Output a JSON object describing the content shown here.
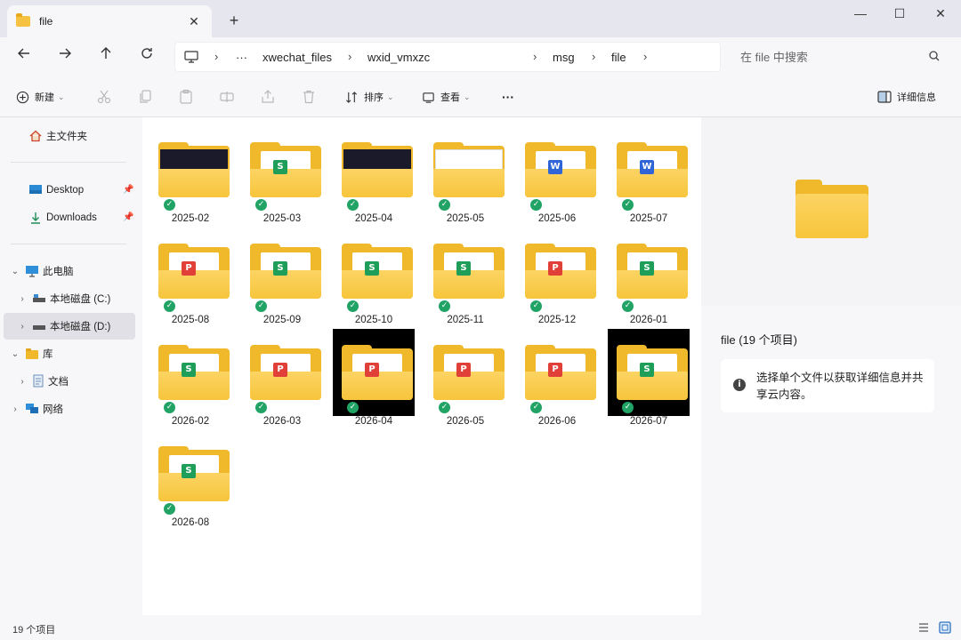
{
  "window": {
    "tab_title": "file",
    "new_tab": "+",
    "min": "—",
    "max": "☐",
    "close": "✕"
  },
  "address": {
    "ellipsis": "···",
    "crumbs": [
      "xwechat_files",
      "wxid_vmxzc",
      "msg",
      "file"
    ],
    "search_placeholder": "在 file 中搜索"
  },
  "toolbar": {
    "new_label": "新建",
    "sort_label": "排序",
    "view_label": "查看",
    "more_label": "···",
    "details_label": "详细信息"
  },
  "sidebar": {
    "home": "主文件夹",
    "desktop": "Desktop",
    "downloads": "Downloads",
    "this_pc": "此电脑",
    "drive_c": "本地磁盘 (C:)",
    "drive_d": "本地磁盘 (D:)",
    "library": "库",
    "documents": "文档",
    "network": "网络"
  },
  "folders": [
    {
      "name": "2025-02",
      "kind": "dark"
    },
    {
      "name": "2025-03",
      "kind": "S"
    },
    {
      "name": "2025-04",
      "kind": "dark"
    },
    {
      "name": "2025-05",
      "kind": "light"
    },
    {
      "name": "2025-06",
      "kind": "W"
    },
    {
      "name": "2025-07",
      "kind": "W"
    },
    {
      "name": "2025-08",
      "kind": "P"
    },
    {
      "name": "2025-09",
      "kind": "S"
    },
    {
      "name": "2025-10",
      "kind": "S"
    },
    {
      "name": "2025-11",
      "kind": "S"
    },
    {
      "name": "2025-12",
      "kind": "P"
    },
    {
      "name": "2026-01",
      "kind": "S"
    },
    {
      "name": "2026-02",
      "kind": "S"
    },
    {
      "name": "2026-03",
      "kind": "P"
    },
    {
      "name": "2026-04",
      "kind": "P",
      "selected": true
    },
    {
      "name": "2026-05",
      "kind": "P"
    },
    {
      "name": "2026-06",
      "kind": "P"
    },
    {
      "name": "2026-07",
      "kind": "S",
      "selected": true
    },
    {
      "name": "2026-08",
      "kind": "S"
    }
  ],
  "details": {
    "title": "file (19 个项目)",
    "info": "选择单个文件以获取详细信息并共享云内容。"
  },
  "status": {
    "count": "19 个项目"
  },
  "colors": {
    "folder": "#f0b92c",
    "sync_ok": "#21a366"
  }
}
